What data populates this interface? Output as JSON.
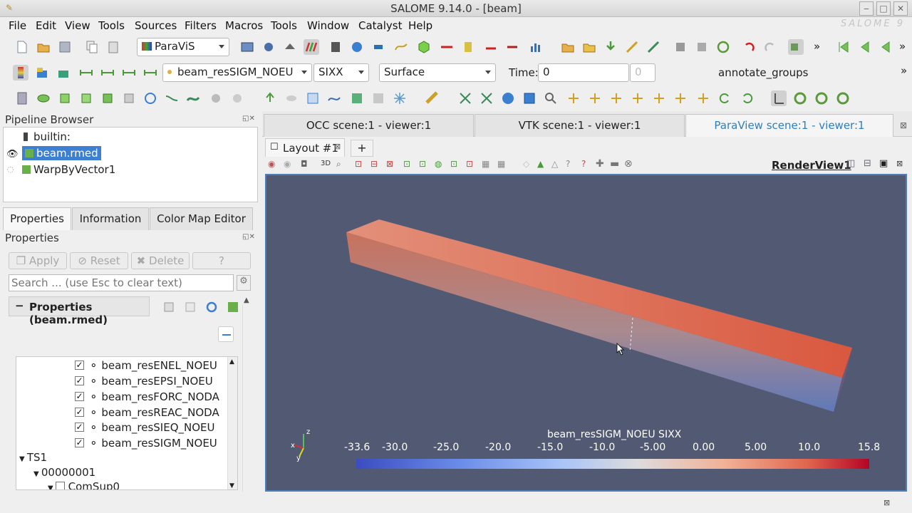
{
  "window": {
    "title": "SALOME 9.14.0 - [beam]",
    "watermark": "SALOME 9"
  },
  "menu": [
    "File",
    "Edit",
    "View",
    "Tools",
    "Sources",
    "Filters",
    "Macros",
    "Tools",
    "Window",
    "Catalyst",
    "Help"
  ],
  "toolbar": {
    "module": "ParaViS",
    "source_combo": "beam_resSIGM_NOEU",
    "component_combo": "SIXX",
    "representation_combo": "Surface",
    "time_label": "Time:",
    "time_value": "0",
    "time_index": "0",
    "annotate": "annotate_groups",
    "more": "»"
  },
  "pipeline": {
    "title": "Pipeline Browser",
    "items": [
      {
        "label": "builtin:"
      },
      {
        "label": "beam.rmed"
      },
      {
        "label": "WarpByVector1"
      }
    ]
  },
  "tabs_left": [
    "Properties",
    "Information",
    "Color Map Editor"
  ],
  "properties": {
    "title": "Properties",
    "apply": "Apply",
    "reset": "Reset",
    "delete": "Delete",
    "help": "?",
    "search_placeholder": "Search ... (use Esc to clear text)",
    "section": "Properties (beam.rmed)",
    "fields": [
      "beam_resENEL_NOEU",
      "beam_resEPSI_NOEU",
      "beam_resFORC_NODA",
      "beam_resREAC_NODA",
      "beam_resSIEQ_NOEU",
      "beam_resSIGM_NOEU"
    ],
    "ts": "TS1",
    "ts_child": "00000001",
    "ts_grandchild": "ComSup0"
  },
  "scene_tabs": [
    "OCC scene:1 - viewer:1",
    "VTK scene:1 - viewer:1",
    "ParaView scene:1 - viewer:1"
  ],
  "layout_tab": "Layout #1",
  "add_tab": "+",
  "renderview": {
    "label": "RenderView1",
    "button_3d": "3D"
  },
  "colorbar": {
    "title": "beam_resSIGM_NOEU SIXX",
    "ticks": [
      "-33.6",
      "-30.0",
      "-25.0",
      "-20.0",
      "-15.0",
      "-10.0",
      "-5.00",
      "0.00",
      "5.00",
      "10.0",
      "15.8"
    ],
    "min_color": "#3b4cc0",
    "max_color": "#b40426"
  },
  "axes": {
    "z": "z",
    "x": "x",
    "y": "y"
  },
  "colors": {
    "viewport_bg": "#525a73",
    "selection": "#3d7fd1",
    "accent_tab_text": "#2f7ec1"
  }
}
